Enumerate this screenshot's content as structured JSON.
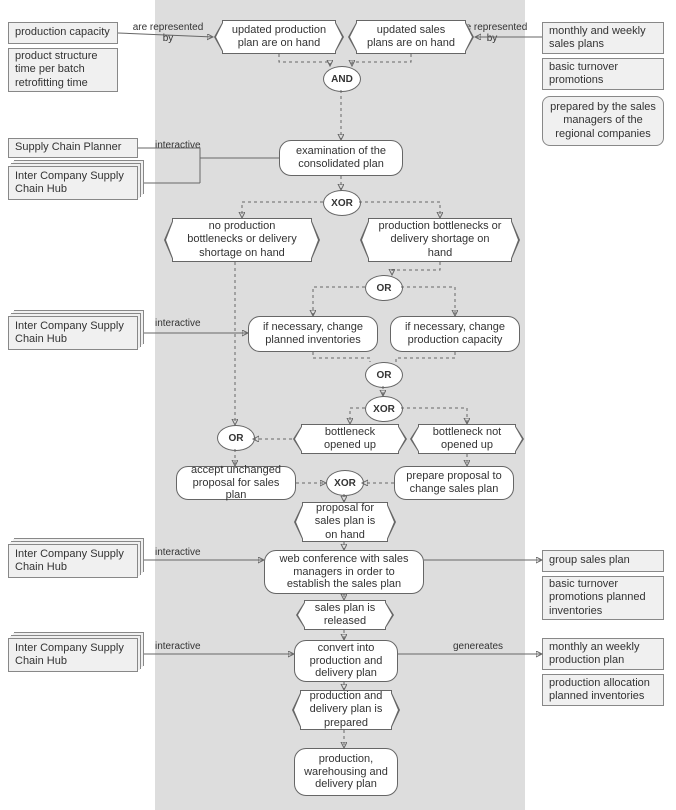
{
  "left": {
    "pc": "production capacity",
    "ps": "product structure time per batch retrofitting time",
    "scp": "Supply Chain Planner",
    "hub": "Inter Company Supply Chain Hub"
  },
  "right": {
    "msp": "monthly and weekly sales plans",
    "btp": "basic turnover promotions",
    "callout": "prepared by the sales managers of the regional companies",
    "gsp": "group sales plan",
    "btpi": "basic turnover promotions planned inventories",
    "mwpp": "monthly an weekly production plan",
    "papi": "production allocation planned inventories"
  },
  "edge": {
    "rep_l": "are represented by",
    "rep_r": "are represented by",
    "int": "interactive",
    "gen": "genereates"
  },
  "gate": {
    "and": "AND",
    "xor": "XOR",
    "or": "OR"
  },
  "node": {
    "upp": "updated production plan are on hand",
    "usp": "updated sales plans are on hand",
    "exam": "examination of the consolidated plan",
    "nobn": "no production bottlenecks or delivery shortage on hand",
    "bn": "production bottlenecks or delivery shortage on hand",
    "chinv": "if necessary, change planned inventories",
    "chcap": "if necessary, change production capacity",
    "bopen": "bottleneck opened up",
    "bnopen": "bottleneck not opened up",
    "accept": "accept unchanged proposal for sales plan",
    "prepare": "prepare proposal to change sales plan",
    "proposal": "proposal for sales plan is on hand",
    "webconf": "web conference with sales managers in order to establish the sales plan",
    "released": "sales plan is released",
    "convert": "convert into production and delivery plan",
    "pdprep": "production and delivery plan is prepared",
    "pwd": "production, warehousing and delivery plan"
  }
}
